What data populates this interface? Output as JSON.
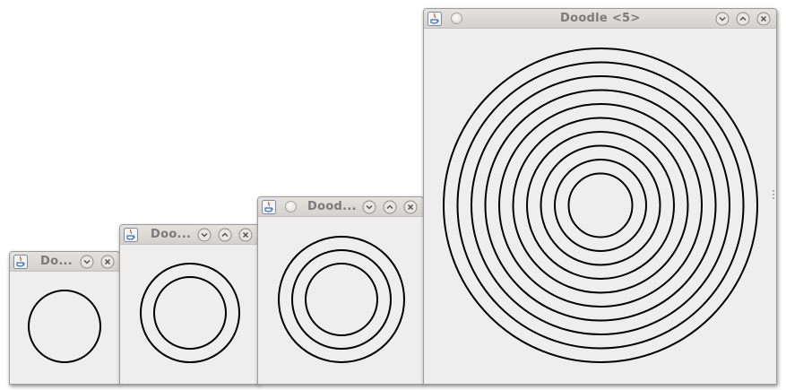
{
  "colors": {
    "stroke": "#000000",
    "canvas": "#eeeeee",
    "titlebar": "#d8d5d1"
  },
  "windows": [
    {
      "id": "w1",
      "title": "Do...",
      "ring_count": 1,
      "sticky": false,
      "maximize": false
    },
    {
      "id": "w2",
      "title": "Doo...",
      "ring_count": 2,
      "sticky": false,
      "maximize": true
    },
    {
      "id": "w3",
      "title": "Dood...",
      "ring_count": 3,
      "sticky": true,
      "maximize": true
    },
    {
      "id": "w5",
      "title": "Doodle <5>",
      "ring_count": 10,
      "sticky": true,
      "maximize": true
    }
  ]
}
